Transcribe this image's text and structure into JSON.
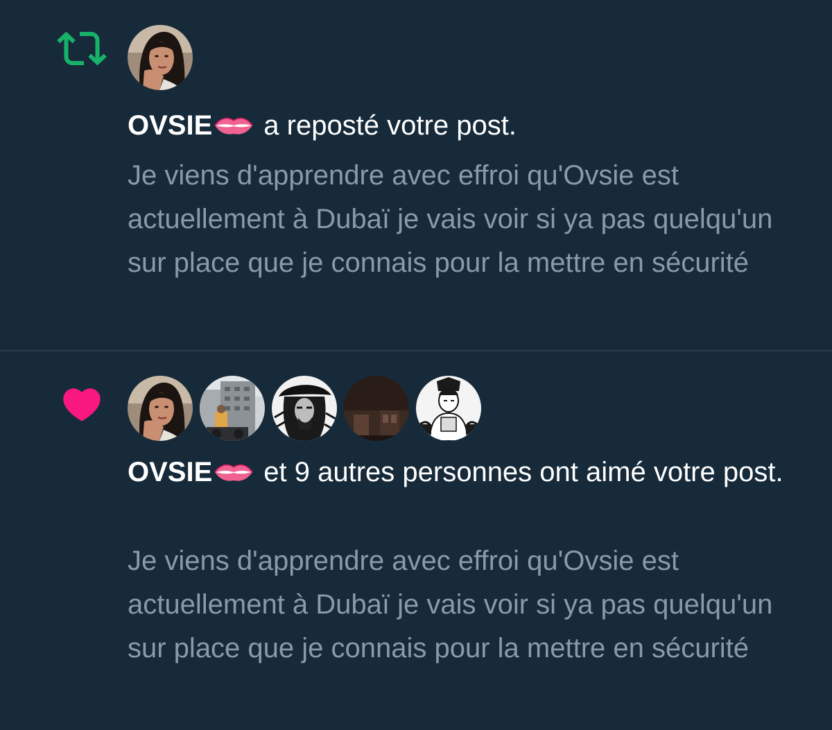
{
  "colors": {
    "background": "#172a3a",
    "divider": "#2a3d4d",
    "primary_text": "#ffffff",
    "secondary_text": "#8a9aa9",
    "repost_green": "#17b26a",
    "like_pink": "#f91880"
  },
  "notifications": [
    {
      "type": "repost",
      "icon": "repost-icon",
      "avatars": [
        "avatar-ovsie"
      ],
      "user_name": "OVSIE",
      "user_emoji": "lips-emoji",
      "action_text": "a reposté votre post.",
      "post_text": "Je viens d'apprendre avec effroi qu'Ovsie est actuellement à Dubaï je vais voir si ya pas quelqu'un sur place que je connais pour la mettre en sécurité"
    },
    {
      "type": "like",
      "icon": "heart-icon",
      "avatars": [
        "avatar-ovsie",
        "avatar-building",
        "avatar-pirate",
        "avatar-dark",
        "avatar-manga"
      ],
      "user_name": "OVSIE",
      "user_emoji": "lips-emoji",
      "action_text": "et 9 autres personnes ont aimé votre post.",
      "post_text": "Je viens d'apprendre avec effroi qu'Ovsie est actuellement à Dubaï je vais voir si ya pas quelqu'un sur place que je connais pour la mettre en sécurité"
    }
  ]
}
